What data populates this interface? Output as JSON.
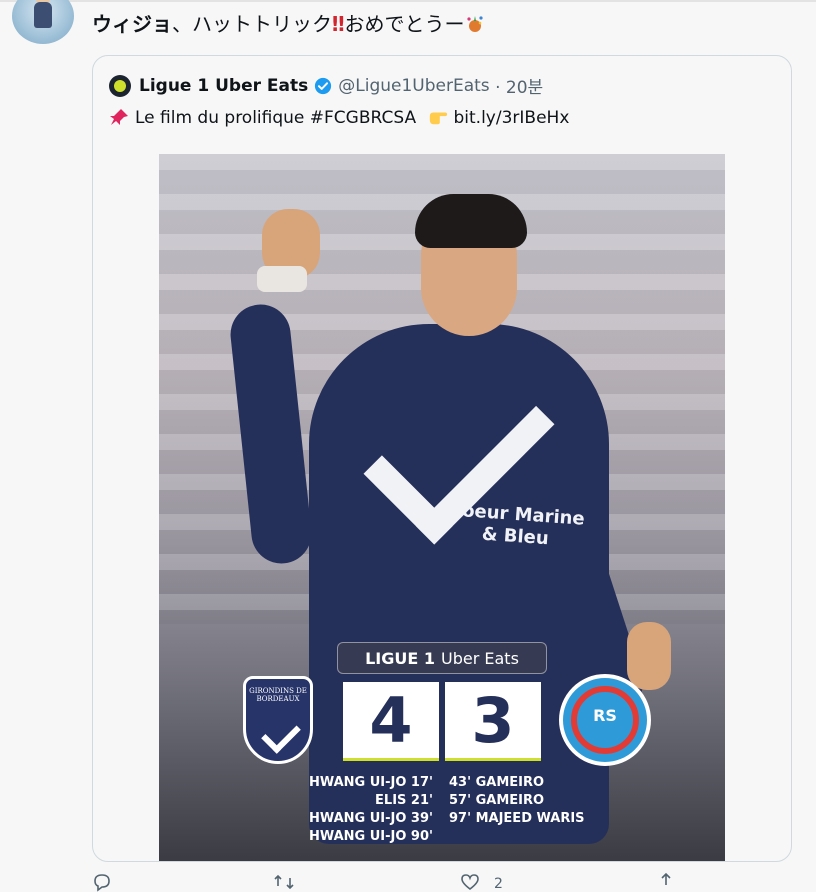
{
  "tweet": {
    "author": "ウィジョ",
    "text_after": "、ハットトリック",
    "text_bang": "‼",
    "text_tail": "おめでとうー"
  },
  "quote": {
    "name": "Ligue 1 Uber Eats",
    "handle": "@Ligue1UberEats",
    "time": "· 20분",
    "body_text": "Le film du prolifique #FCGBRCSA",
    "link": "bit.ly/3rIBeHx"
  },
  "media": {
    "league": "LIGUE 1",
    "league_sponsor": "Uber Eats",
    "home_score": "4",
    "away_score": "3",
    "home_crest_text": "GIRONDINS DE BORDEAUX",
    "away_crest_text": "RS",
    "sponsor_text": "Coeur Marine & Bleu",
    "home_scorers": [
      "HWANG UI-JO 17'",
      "ELIS 21'",
      "HWANG UI-JO 39'",
      "HWANG UI-JO 90'"
    ],
    "away_scorers": [
      "43' GAMEIRO",
      "57' GAMEIRO",
      "97' MAJEED WARIS"
    ]
  },
  "actions": {
    "like_count": "2"
  },
  "colors": {
    "accent": "#1d9bf0",
    "text_secondary": "#536471",
    "bordeaux_navy": "#25305a",
    "ligue_green": "#cfe02c"
  }
}
